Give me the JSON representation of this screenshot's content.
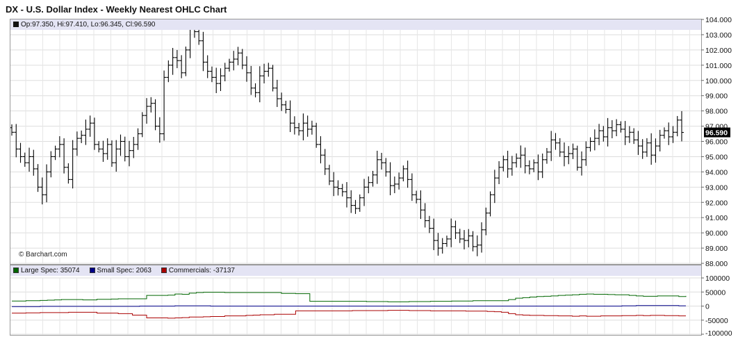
{
  "chart_data": [
    {
      "type": "ohlc",
      "title": "DX - U.S. Dollar Index - Weekly Nearest OHLC Chart",
      "info": "Op:97.350, Hi:97.410, Lo:96.345, Cl:96.590",
      "watermark": "© Barchart.com",
      "last_price_label": "96.590",
      "ylim": [
        88,
        104
      ],
      "yticks": [
        "104.000",
        "103.000",
        "102.000",
        "101.000",
        "100.000",
        "99.000",
        "98.000",
        "97.000",
        "96.000",
        "95.000",
        "94.000",
        "93.000",
        "92.000",
        "91.000",
        "90.000",
        "89.000",
        "88.000"
      ],
      "grid": true,
      "closes": [
        96.6,
        95.5,
        95,
        94.6,
        95,
        94.2,
        93,
        92.5,
        94,
        95,
        95.5,
        95.8,
        94.3,
        93.5,
        95.5,
        96.2,
        96.4,
        96.8,
        97.2,
        95.8,
        95.5,
        95.2,
        95.8,
        94.6,
        95.5,
        96,
        95,
        95.4,
        95.8,
        96.5,
        97.7,
        98.3,
        98.5,
        97,
        96.5,
        100.2,
        101,
        101.5,
        101.3,
        100.5,
        102,
        103.5,
        103.2,
        102.6,
        101.2,
        100.6,
        100.2,
        99.8,
        100.3,
        100.8,
        101.2,
        101.4,
        101.8,
        101,
        100.5,
        99.5,
        99.2,
        100.3,
        100.6,
        100.8,
        99.5,
        98.8,
        98.4,
        98.1,
        97.2,
        96.9,
        96.7,
        97.2,
        96.8,
        97.0,
        95.8,
        95.1,
        94.2,
        93.4,
        93.0,
        92.9,
        92.7,
        92.3,
        91.8,
        91.6,
        92.3,
        93.0,
        93.3,
        93.8,
        94.8,
        94.6,
        94.0,
        93.1,
        93.2,
        93.6,
        94.2,
        93.5,
        92.5,
        92.2,
        91.5,
        90.8,
        90.3,
        89.5,
        89.0,
        89.3,
        89.6,
        90.4,
        90.0,
        89.6,
        89.5,
        89.8,
        89.1,
        89.2,
        90.2,
        91.3,
        92.5,
        93.6,
        94.3,
        94.8,
        94.2,
        94.6,
        94.9,
        95.1,
        94.4,
        94.2,
        94.6,
        94.0,
        94.8,
        95.3,
        96.1,
        95.9,
        95.3,
        95.0,
        95.2,
        95.5,
        94.3,
        94.8,
        95.6,
        96.0,
        96.2,
        96.7,
        96.3,
        96.9,
        96.7,
        97.1,
        96.8,
        96.3,
        96.6,
        96.1,
        95.7,
        95.3,
        95.9,
        95.1,
        95.7,
        96.4,
        96.7,
        96.3,
        96.6,
        97.4,
        96.59
      ],
      "legend": [
        {
          "label": "Large Spec: 35074",
          "color": "#006600"
        },
        {
          "label": "Small Spec: 2063",
          "color": "#000088"
        },
        {
          "label": "Commercials: -37137",
          "color": "#aa0000"
        }
      ]
    },
    {
      "type": "line",
      "ylim": [
        -100000,
        100000
      ],
      "yticks": [
        "100000",
        "50000",
        "0",
        "-50000",
        "-100000"
      ],
      "grid": true,
      "series": [
        {
          "name": "Large Spec: 35074",
          "color": "#006600",
          "values": [
            0,
            0,
            1,
            1,
            2,
            3,
            4,
            5,
            5,
            5,
            4,
            4,
            6,
            6,
            7,
            8,
            8,
            8,
            8,
            20,
            20,
            20,
            21,
            25,
            24,
            28,
            30,
            31,
            31,
            31,
            30,
            30,
            30,
            30,
            30,
            30,
            30,
            30,
            27,
            27,
            26,
            26,
            -1,
            -1,
            -1,
            -1,
            -1,
            -1,
            -1,
            -1,
            -2,
            -2,
            -2,
            -3,
            -3,
            -3,
            -2,
            -2,
            -2,
            -1,
            -1,
            -1,
            0,
            0,
            0,
            1,
            1,
            1,
            1,
            1,
            5,
            10,
            12,
            14,
            16,
            17,
            18,
            20,
            21,
            22,
            24,
            25,
            24,
            24,
            23,
            22,
            22,
            20,
            18,
            17,
            17,
            18,
            18,
            18,
            16,
            18
          ]
        },
        {
          "name": "Small Spec: 2063",
          "color": "#000088",
          "values": [
            -2,
            -2,
            -2,
            -2,
            -1,
            -1,
            -1,
            -1,
            -1,
            -1,
            -1,
            -1,
            -1,
            -1,
            -1,
            -1,
            -1,
            -1,
            0,
            0,
            0,
            0,
            0,
            1,
            1,
            1,
            1,
            1,
            0,
            0,
            0,
            0,
            0,
            0,
            0,
            0,
            0,
            0,
            0,
            0,
            0,
            0,
            0,
            0,
            0,
            0,
            0,
            0,
            0,
            0,
            0,
            0,
            0,
            0,
            0,
            0,
            0,
            0,
            0,
            0,
            0,
            0,
            0,
            0,
            0,
            0,
            0,
            0,
            0,
            0,
            0,
            0,
            0,
            0,
            0,
            0,
            0,
            0,
            0,
            0,
            0,
            0,
            0,
            0,
            0,
            0,
            1,
            1,
            2,
            2,
            2,
            2,
            2,
            2,
            1,
            1
          ]
        },
        {
          "name": "Commercials: -37137",
          "color": "#aa0000",
          "values": [
            -8,
            -8,
            -7,
            -7,
            -6,
            -6,
            -6,
            -6,
            -5,
            -5,
            -5,
            -5,
            -8,
            -8,
            -8,
            -10,
            -10,
            -15,
            -15,
            -25,
            -25,
            -25,
            -26,
            -25,
            -24,
            -22,
            -22,
            -21,
            -20,
            -20,
            -18,
            -18,
            -18,
            -16,
            -15,
            -14,
            -14,
            -12,
            -12,
            -12,
            0,
            0,
            0,
            0,
            0,
            0,
            0,
            0,
            1,
            1,
            1,
            1,
            1,
            2,
            2,
            2,
            1,
            1,
            1,
            0,
            0,
            0,
            0,
            0,
            -1,
            -1,
            -1,
            -2,
            -3,
            -5,
            -10,
            -14,
            -15,
            -16,
            -16,
            -17,
            -17,
            -18,
            -18,
            -19,
            -18,
            -19,
            -19,
            -18,
            -18,
            -18,
            -17,
            -17,
            -16,
            -17,
            -16,
            -16,
            -17,
            -17,
            -18,
            -18
          ]
        }
      ]
    }
  ]
}
